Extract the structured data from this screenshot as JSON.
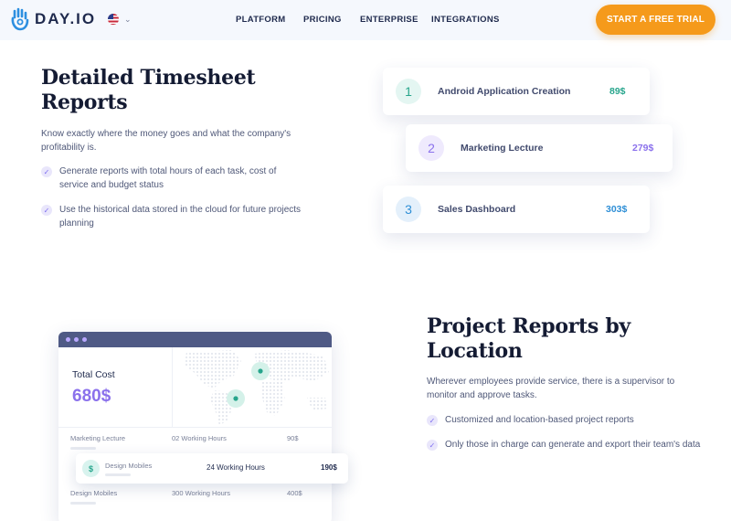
{
  "header": {
    "logo_text": "DAY.IO",
    "nav": [
      "PLATFORM",
      "PRICING",
      "ENTERPRISE",
      "INTEGRATIONS"
    ],
    "cta_label": "START A FREE TRIAL",
    "language_icon": "us-flag-icon"
  },
  "timesheet": {
    "title": "Detailed Timesheet Reports",
    "description": "Know exactly where the money goes and what the company's profitability is.",
    "bullets": [
      "Generate reports with total hours of each task, cost of service and budget status",
      "Use the historical data stored in the cloud for future projects planning"
    ],
    "cards": [
      {
        "num": "1",
        "title": "Android Application Creation",
        "price": "89$"
      },
      {
        "num": "2",
        "title": "Marketing Lecture",
        "price": "279$"
      },
      {
        "num": "3",
        "title": "Sales Dashboard",
        "price": "303$"
      }
    ]
  },
  "location": {
    "title": "Project Reports by Location",
    "description": "Wherever employees provide service, there is a supervisor to monitor and approve tasks.",
    "bullets": [
      "Customized and location-based project reports",
      "Only those in charge can generate and export their team's data"
    ]
  },
  "dashboard": {
    "total_label": "Total Cost",
    "total_value": "680$",
    "rows": [
      {
        "name": "Marketing Lecture",
        "hours": "02 Working Hours",
        "cost": "90$"
      },
      {
        "name": "Design Mobiles",
        "hours": "24 Working Hours",
        "cost": "190$"
      },
      {
        "name": "Design Mobiles",
        "hours": "300 Working Hours",
        "cost": "400$"
      }
    ]
  },
  "colors": {
    "accent_orange": "#f59a1b",
    "purple": "#8b71ec",
    "teal": "#27a58c",
    "blue": "#2f8fd6",
    "navy": "#141b33"
  }
}
